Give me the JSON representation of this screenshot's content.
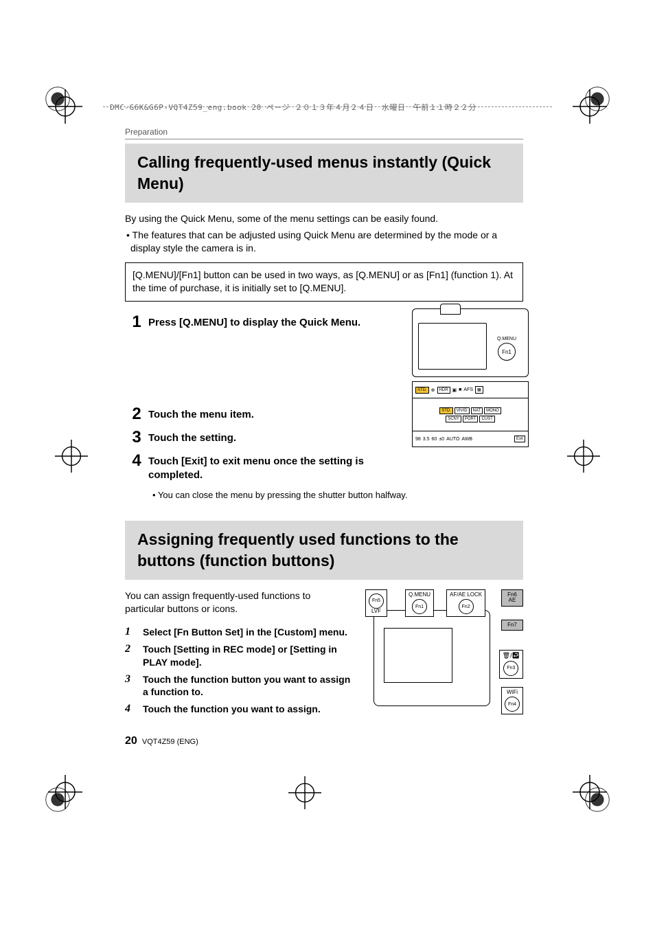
{
  "header_line": "DMC-G6K&G6P-VQT4Z59_eng.book  20 ページ  ２０１３年４月２４日　水曜日　午前１１時２２分",
  "section_label": "Preparation",
  "heading1": "Calling frequently-used menus instantly (Quick Menu)",
  "intro1": "By using the Quick Menu, some of the menu settings can be easily found.",
  "intro1_sub": "The features that can be adjusted using Quick Menu are determined by the mode or a display style the camera is in.",
  "note_box": "[Q.MENU]/[Fn1] button can be used in two ways, as [Q.MENU] or as [Fn1] (function 1). At the time of purchase, it is initially set to [Q.MENU].",
  "steps1": [
    {
      "n": "1",
      "t": "Press [Q.MENU] to display the Quick Menu."
    },
    {
      "n": "2",
      "t": "Touch the menu item."
    },
    {
      "n": "3",
      "t": "Touch the setting."
    },
    {
      "n": "4",
      "t": "Touch [Exit] to exit menu once the setting is completed."
    }
  ],
  "step4_note": "You can close the menu by pressing the shutter button halfway.",
  "diagram1": {
    "qmenu_label": "Q.MENU",
    "fn1_label": "Fn1",
    "row1_items": [
      "STD.",
      "⊕",
      "HDR",
      "▣",
      "■",
      "AFS",
      "▦"
    ],
    "row2_top": [
      "STD.",
      "VIVID",
      "NAT",
      "MONO"
    ],
    "row2_bot": [
      "SCNY",
      "PORT",
      "CUST"
    ],
    "row3_items": [
      "98",
      "3.5",
      "60",
      "±0",
      "AUTO",
      "AWB",
      "Exit"
    ]
  },
  "heading2": "Assigning frequently used functions to the buttons (function buttons)",
  "intro2": "You can assign frequently-used functions to particular buttons or icons.",
  "steps2": [
    {
      "n": "1",
      "t": "Select [Fn Button Set] in the [Custom] menu."
    },
    {
      "n": "2",
      "t": "Touch [Setting in REC mode] or [Setting in PLAY mode]."
    },
    {
      "n": "3",
      "t": "Touch the function button you want to assign a function to."
    },
    {
      "n": "4",
      "t": "Touch the function you want to assign."
    }
  ],
  "diagram2": {
    "fn5": {
      "top": "Fn5",
      "bot": "LVF"
    },
    "fn1": {
      "top": "Q.MENU",
      "circ": "Fn1"
    },
    "fn2": {
      "top": "AF/AE LOCK",
      "circ": "Fn2"
    },
    "fn6": {
      "top": "Fn6",
      "bot": "AE"
    },
    "fn7": {
      "top": "Fn7",
      "bot": ""
    },
    "fn3": {
      "top": "",
      "circ": "Fn3"
    },
    "fn4": {
      "top": "WiFi",
      "circ": "Fn4"
    }
  },
  "footer": {
    "page": "20",
    "code": "VQT4Z59 (ENG)"
  }
}
